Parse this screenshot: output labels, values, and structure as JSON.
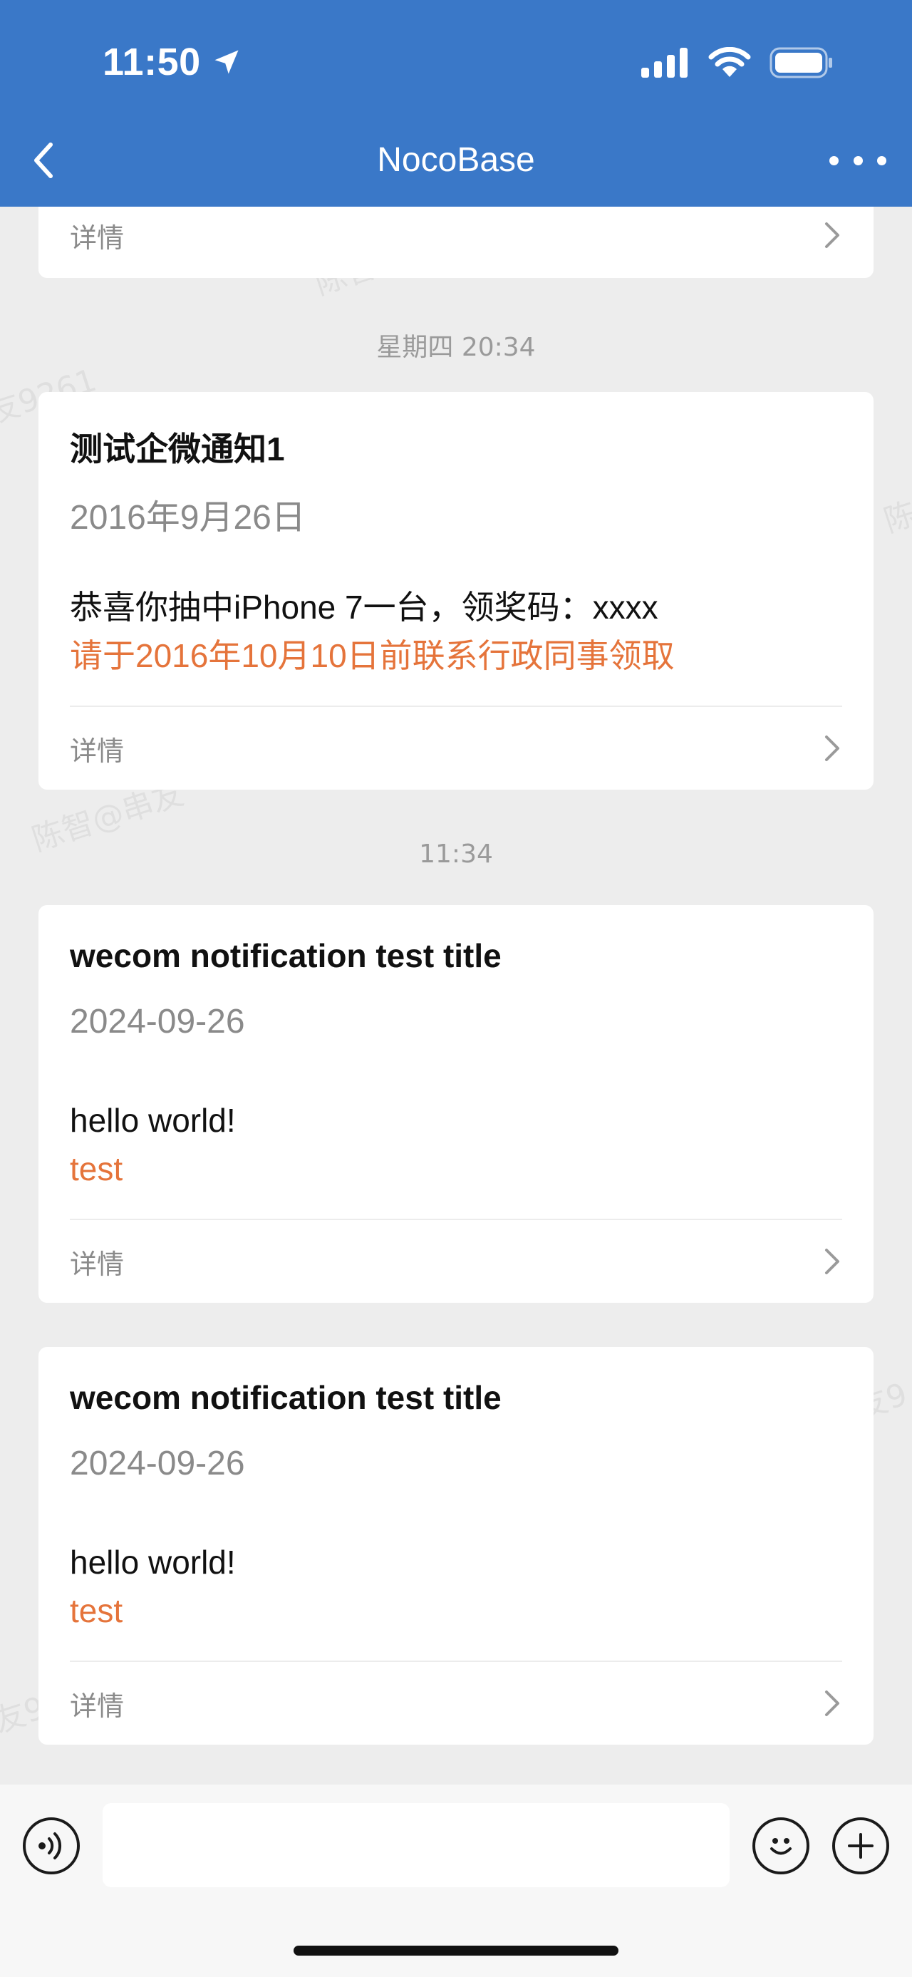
{
  "status": {
    "time": "11:50"
  },
  "nav": {
    "title": "NocoBase"
  },
  "partial_card": {
    "detail_label": "详情"
  },
  "timestamps": {
    "first": "星期四 20:34",
    "second": "11:34"
  },
  "cards": [
    {
      "title": "测试企微通知1",
      "date": "2016年9月26日",
      "body": "恭喜你抽中iPhone 7一台，领奖码：xxxx",
      "accent": "请于2016年10月10日前联系行政同事领取",
      "detail_label": "详情"
    },
    {
      "title": "wecom notification test title",
      "date": "2024-09-26",
      "body": "hello world!",
      "accent": "test",
      "detail_label": "详情"
    },
    {
      "title": "wecom notification test title",
      "date": "2024-09-26",
      "body": "hello world!",
      "accent": "test",
      "detail_label": "详情"
    }
  ],
  "input": {
    "placeholder": ""
  },
  "colors": {
    "header": "#3a78c8",
    "accent": "#e5743b",
    "background": "#ededed"
  },
  "icons": [
    "location-arrow-icon",
    "cellular-signal-icon",
    "wifi-icon",
    "battery-icon",
    "back-chevron-icon",
    "more-icon",
    "chevron-right-icon",
    "voice-icon",
    "emoji-icon",
    "add-icon"
  ]
}
